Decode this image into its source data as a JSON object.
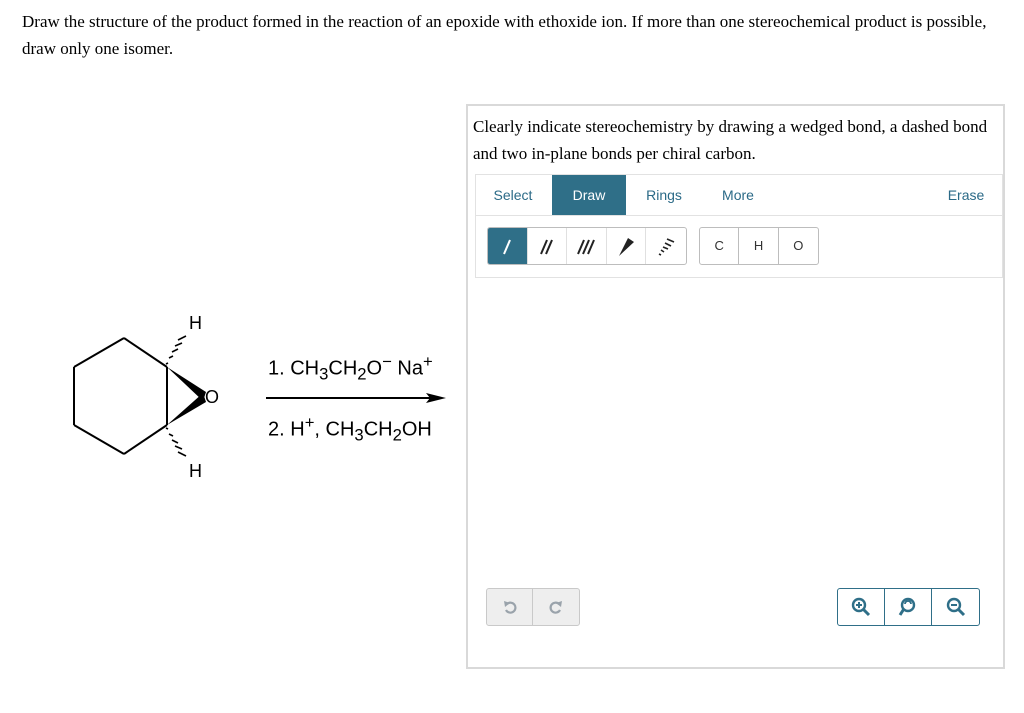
{
  "question": {
    "text": "Draw the structure of the product formed in the reaction of an epoxide with ethoxide ion. If more than one stereochemical product is possible, draw only one isomer."
  },
  "reaction": {
    "atom_labels": {
      "hydrogen_top": "H",
      "hydrogen_bottom": "H",
      "oxygen": "O"
    },
    "reagent_step1": {
      "prefix": "1. CH",
      "sub1": "3",
      "mid1": "CH",
      "sub2": "2",
      "mid2": "O",
      "charge": "−",
      "tail": " Na",
      "sup": "+"
    },
    "reagent_step2": {
      "prefix": "2. H",
      "sup": "+",
      "mid1": ", CH",
      "sub1": "3",
      "mid2": "CH",
      "sub2": "2",
      "tail": "OH"
    }
  },
  "panel": {
    "instruction": "Clearly indicate stereochemistry by drawing a wedged bond, a dashed bond and two in-plane bonds per chiral carbon.",
    "tabs": {
      "select": "Select",
      "draw": "Draw",
      "rings": "Rings",
      "more": "More",
      "erase": "Erase"
    },
    "atoms": {
      "carbon": "C",
      "hydrogen": "H",
      "oxygen": "O"
    }
  },
  "colors": {
    "accent": "#2f6f88",
    "link_text": "#2b6a87"
  },
  "icons": {
    "bond_tools": [
      "single-bond-icon",
      "double-bond-icon",
      "triple-bond-icon",
      "wedge-bond-icon",
      "hash-bond-icon"
    ],
    "history": [
      "undo-icon",
      "redo-icon"
    ],
    "zoom": [
      "zoom-in-icon",
      "reset-zoom-icon",
      "zoom-out-icon"
    ]
  }
}
